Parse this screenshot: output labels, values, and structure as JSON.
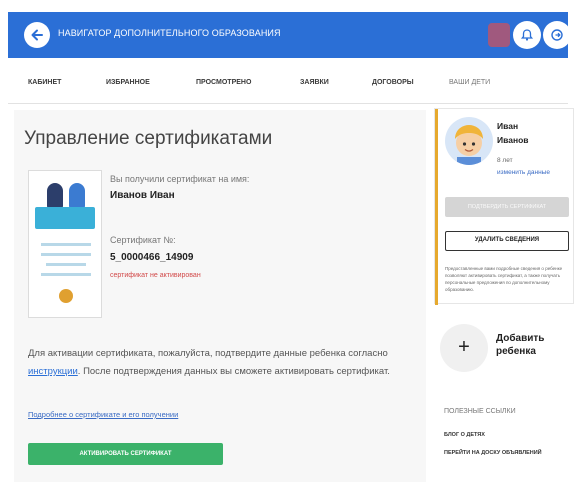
{
  "header": {
    "title": "НАВИГАТОР ДОПОЛНИТЕЛЬНОГО ОБРАЗОВАНИЯ",
    "back_icon": "arrow-left-icon",
    "badge_icon": "bell-icon",
    "logout_icon": "logout-icon",
    "brand_color": "#2b6fd6"
  },
  "nav": {
    "items": [
      {
        "label": "КАБИНЕТ"
      },
      {
        "label": "ИЗБРАННОЕ"
      },
      {
        "label": "ПРОСМОТРЕНО"
      },
      {
        "label": "ЗАЯВКИ"
      },
      {
        "label": "ДОГОВОРЫ"
      },
      {
        "label": "ВАШИ ДЕТИ"
      }
    ]
  },
  "main": {
    "title": "Управление сертификатами",
    "received_label": "Вы получили сертификат на имя:",
    "holder_name": "Иванов Иван",
    "cert_number_label": "Сертификат №:",
    "cert_number": "5_0000466_14909",
    "cert_status": "сертификат не активирован",
    "paragraph_part1": "Для активации сертификата, пожалуйста, подтвердите данные ребенка согласно ",
    "paragraph_link": "инструкции",
    "paragraph_part2": ". После подтверждения данных вы сможете активировать сертификат.",
    "more_link": "Подробнее о сертификате и его получении",
    "activate_button": "АКТИВИРОВАТЬ СЕРТИФИКАТ",
    "activate_color": "#3bb26a",
    "status_color": "#d24a4a"
  },
  "child": {
    "first_name": "Иван",
    "last_name": "Иванов",
    "age": "8 лет",
    "edit_link": "изменить данные",
    "confirm_button": "ПОДТВЕРДИТЬ СЕРТИФИКАТ",
    "delete_button": "УДАЛИТЬ СВЕДЕНИЯ",
    "notice": "Предоставленные вами подробные сведения о ребенке позволяют активировать сертификат, а также получать персональные предложения по дополнительному образованию.",
    "accent_color": "#e6a92e"
  },
  "add_child": {
    "icon": "plus-icon",
    "label_line1": "Добавить",
    "label_line2": "ребенка"
  },
  "useful_links": {
    "title": "ПОЛЕЗНЫЕ ССЫЛКИ",
    "items": [
      {
        "label": "БЛОГ О ДЕТЯХ"
      },
      {
        "label": "ПЕРЕЙТИ НА ДОСКУ ОБЪЯВЛЕНИЙ"
      }
    ]
  }
}
